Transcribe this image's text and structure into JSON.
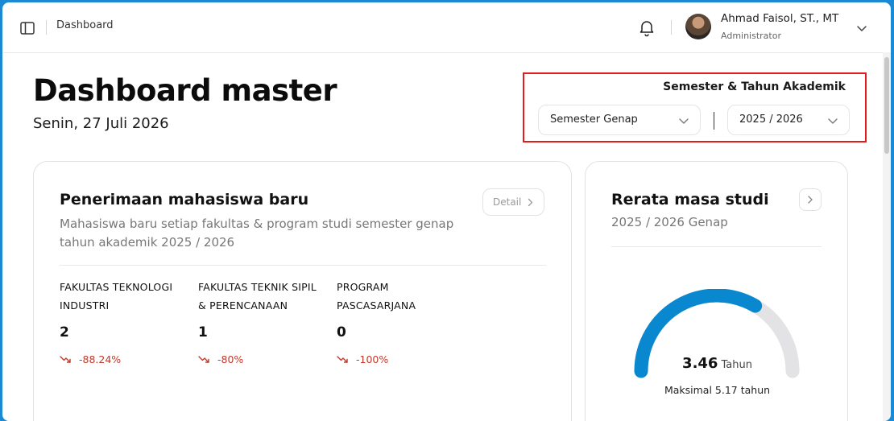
{
  "topbar": {
    "breadcrumb": "Dashboard",
    "user_name": "Ahmad Faisol, ST., MT",
    "user_role": "Administrator"
  },
  "header": {
    "title": "Dashboard master",
    "date": "Senin, 27 Juli 2026"
  },
  "filter": {
    "label": "Semester & Tahun Akademik",
    "semester": "Semester Genap",
    "year": "2025 / 2026"
  },
  "admissions_card": {
    "title": "Penerimaan mahasiswa baru",
    "subtitle": "Mahasiswa baru setiap fakultas & program studi semester genap tahun akademik 2025 / 2026",
    "detail_label": "Detail",
    "faculties": [
      {
        "name": "FAKULTAS TEKNOLOGI INDUSTRI",
        "count": "2",
        "change": "-88.24%"
      },
      {
        "name": "FAKULTAS TEKNIK SIPIL & PERENCANAAN",
        "count": "1",
        "change": "-80%"
      },
      {
        "name": "PROGRAM PASCASARJANA",
        "count": "0",
        "change": "-100%"
      }
    ]
  },
  "study_card": {
    "title": "Rerata masa studi",
    "subtitle": "2025 / 2026 Genap",
    "value": "3.46",
    "unit": "Tahun",
    "max_label": "Maksimal 5.17 tahun",
    "value_number": 3.46,
    "max_number": 5.17
  },
  "colors": {
    "accent": "#0a88cf",
    "negative": "#c0392b",
    "highlight_border": "#e21b1b"
  }
}
